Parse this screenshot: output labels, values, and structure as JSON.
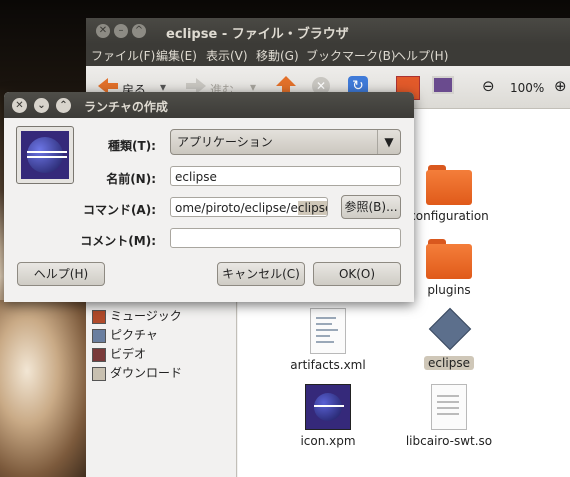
{
  "file_browser": {
    "title": "eclipse - ファイル・ブラウザ",
    "menus": [
      "ファイル(F)",
      "編集(E)",
      "表示(V)",
      "移動(G)",
      "ブックマーク(B)",
      "ヘルプ(H)"
    ],
    "toolbar": {
      "back_label": "戻る",
      "forward_label": "進む",
      "zoom": "100%"
    },
    "sidebar_items": [
      {
        "label": "ミュージック",
        "icon": "music-folder-icon"
      },
      {
        "label": "ピクチャ",
        "icon": "pictures-folder-icon"
      },
      {
        "label": "ビデオ",
        "icon": "videos-folder-icon"
      },
      {
        "label": "ダウンロード",
        "icon": "downloads-folder-icon"
      }
    ],
    "files": [
      {
        "label": "configuration",
        "icon": "folder-icon"
      },
      {
        "label": "plugins",
        "icon": "folder-icon"
      },
      {
        "label": "artifacts.xml",
        "icon": "xml-file-icon"
      },
      {
        "label": "eclipse",
        "icon": "executable-file-icon",
        "selected": true
      },
      {
        "label": "icon.xpm",
        "icon": "image-file-icon"
      },
      {
        "label": "libcairo-swt.so",
        "icon": "library-file-icon"
      }
    ]
  },
  "dialog": {
    "title": "ランチャの作成",
    "type_label": "種類(T):",
    "type_value": "アプリケーション",
    "name_label": "名前(N):",
    "name_value": "eclipse",
    "command_label": "コマンド(A):",
    "command_value_prefix": "ome/piroto/eclipse/e",
    "command_value_selected": "clipse",
    "browse_button": "参照(B)...",
    "comment_label": "コメント(M):",
    "comment_value": "",
    "help_button": "ヘルプ(H)",
    "cancel_button": "キャンセル(C)",
    "ok_button": "OK(O)"
  },
  "colors": {
    "titlebar": "#3c3b37",
    "title_text": "#dfdbd2",
    "window_bg": "#f2f1f0",
    "folder_orange": "#e05a1a",
    "selection": "#cfc7b8"
  }
}
